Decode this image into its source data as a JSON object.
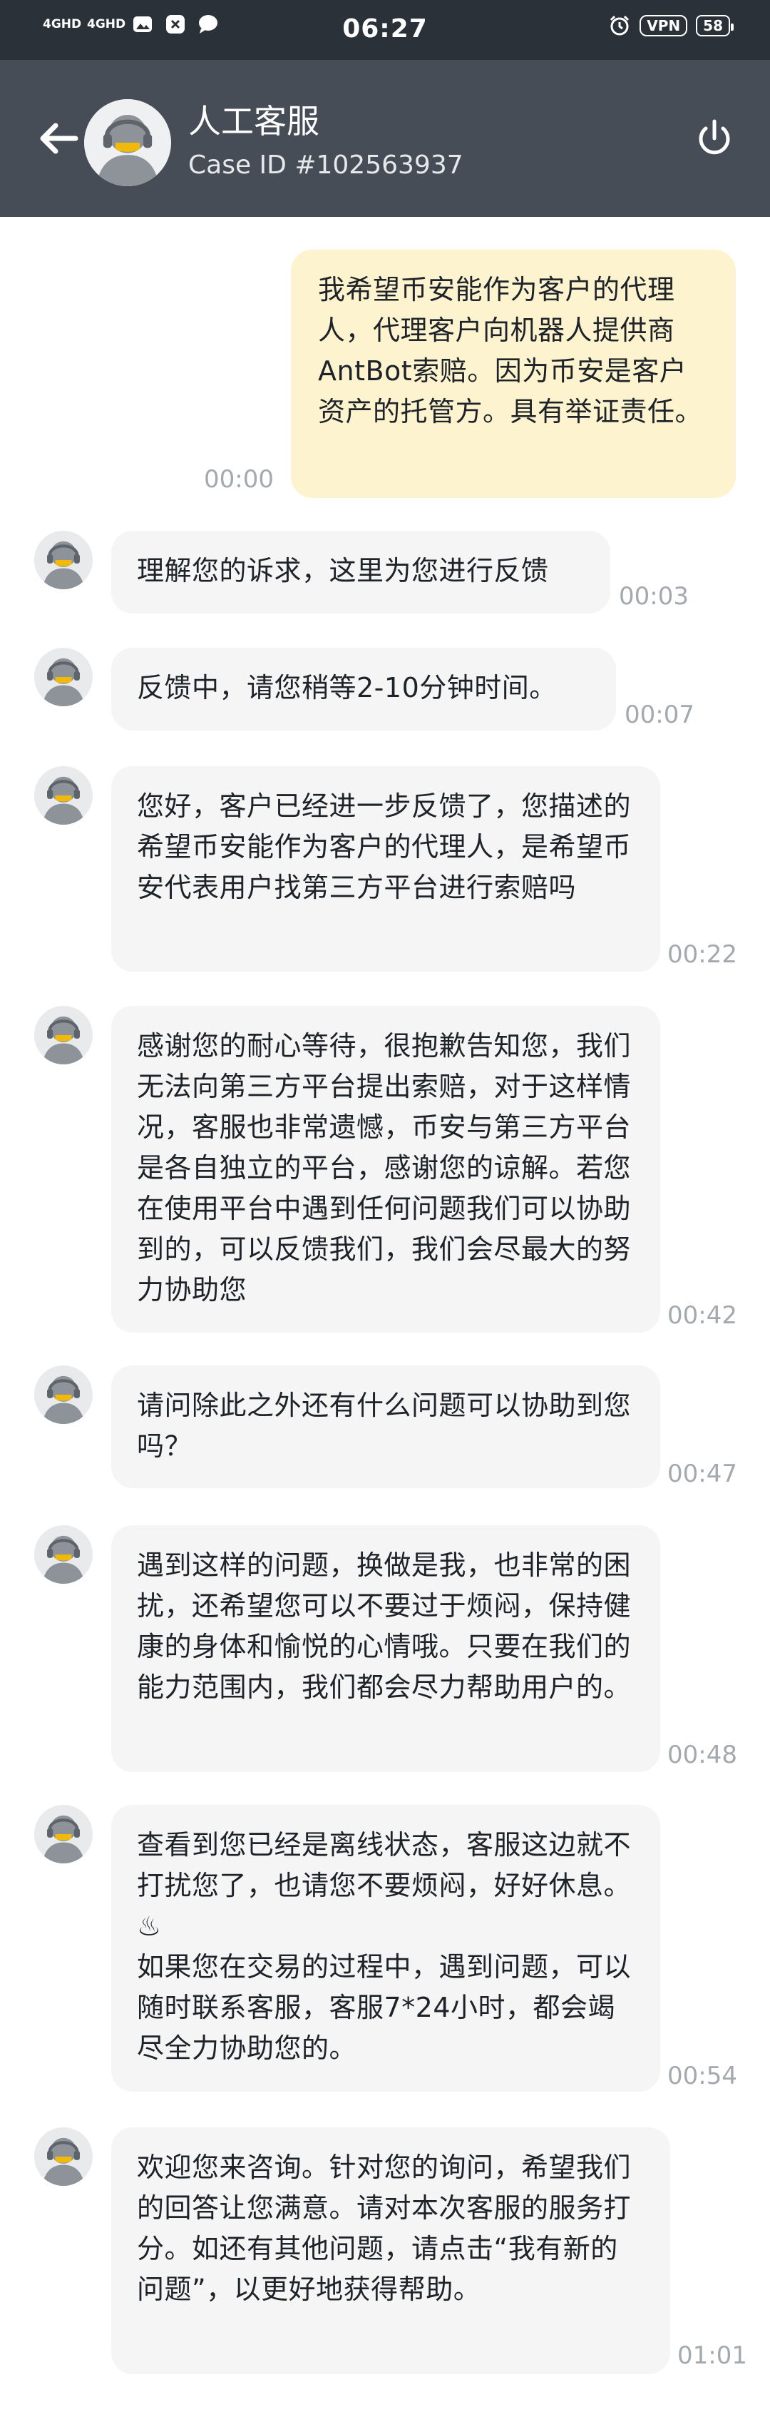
{
  "status_bar": {
    "network_1": "4GHD",
    "network_2": "4GHD",
    "time": "06:27",
    "vpn": "VPN",
    "battery": "58"
  },
  "header": {
    "title": "人工客服",
    "case_id": "Case ID #102563937"
  },
  "messages": [
    {
      "role": "user",
      "text": "我希望币安能作为客户的代理人，代理客户向机器人提供商AntBot索赔。因为币安是客户资产的托管方。具有举证责任。",
      "time": "00:00"
    },
    {
      "role": "agent",
      "text": "理解您的诉求，这里为您进行反馈",
      "time": "00:03"
    },
    {
      "role": "agent",
      "text": "反馈中，请您稍等2-10分钟时间。",
      "time": "00:07"
    },
    {
      "role": "agent",
      "text": "您好，客户已经进一步反馈了，您描述的希望币安能作为客户的代理人，是希望币安代表用户找第三方平台进行索赔吗",
      "time": "00:22"
    },
    {
      "role": "agent",
      "text": "感谢您的耐心等待，很抱歉告知您，我们无法向第三方平台提出索赔，对于这样情况，客服也非常遗憾，币安与第三方平台是各自独立的平台，感谢您的谅解。若您在使用平台中遇到任何问题我们可以协助到的，可以反馈我们，我们会尽最大的努力协助您",
      "time": "00:42"
    },
    {
      "role": "agent",
      "text": "请问除此之外还有什么问题可以协助到您吗？",
      "time": "00:47"
    },
    {
      "role": "agent",
      "text": "遇到这样的问题，换做是我，也非常的困扰，还希望您可以不要过于烦闷，保持健康的身体和愉悦的心情哦。只要在我们的能力范围内，我们都会尽力帮助用户的。",
      "time": "00:48"
    },
    {
      "role": "agent",
      "text": "查看到您已经是离线状态，客服这边就不打扰您了，也请您不要烦闷，好好休息。♨\n如果您在交易的过程中，遇到问题，可以随时联系客服，客服7*24小时，都会竭尽全力协助您的。",
      "time": "00:54"
    },
    {
      "role": "agent",
      "text": "欢迎您来咨询。针对您的询问，希望我们的回答让您满意。请对本次客服的服务打分。如还有其他问题，请点击“我有新的问题”，以更好地获得帮助。",
      "time": "01:01"
    }
  ]
}
